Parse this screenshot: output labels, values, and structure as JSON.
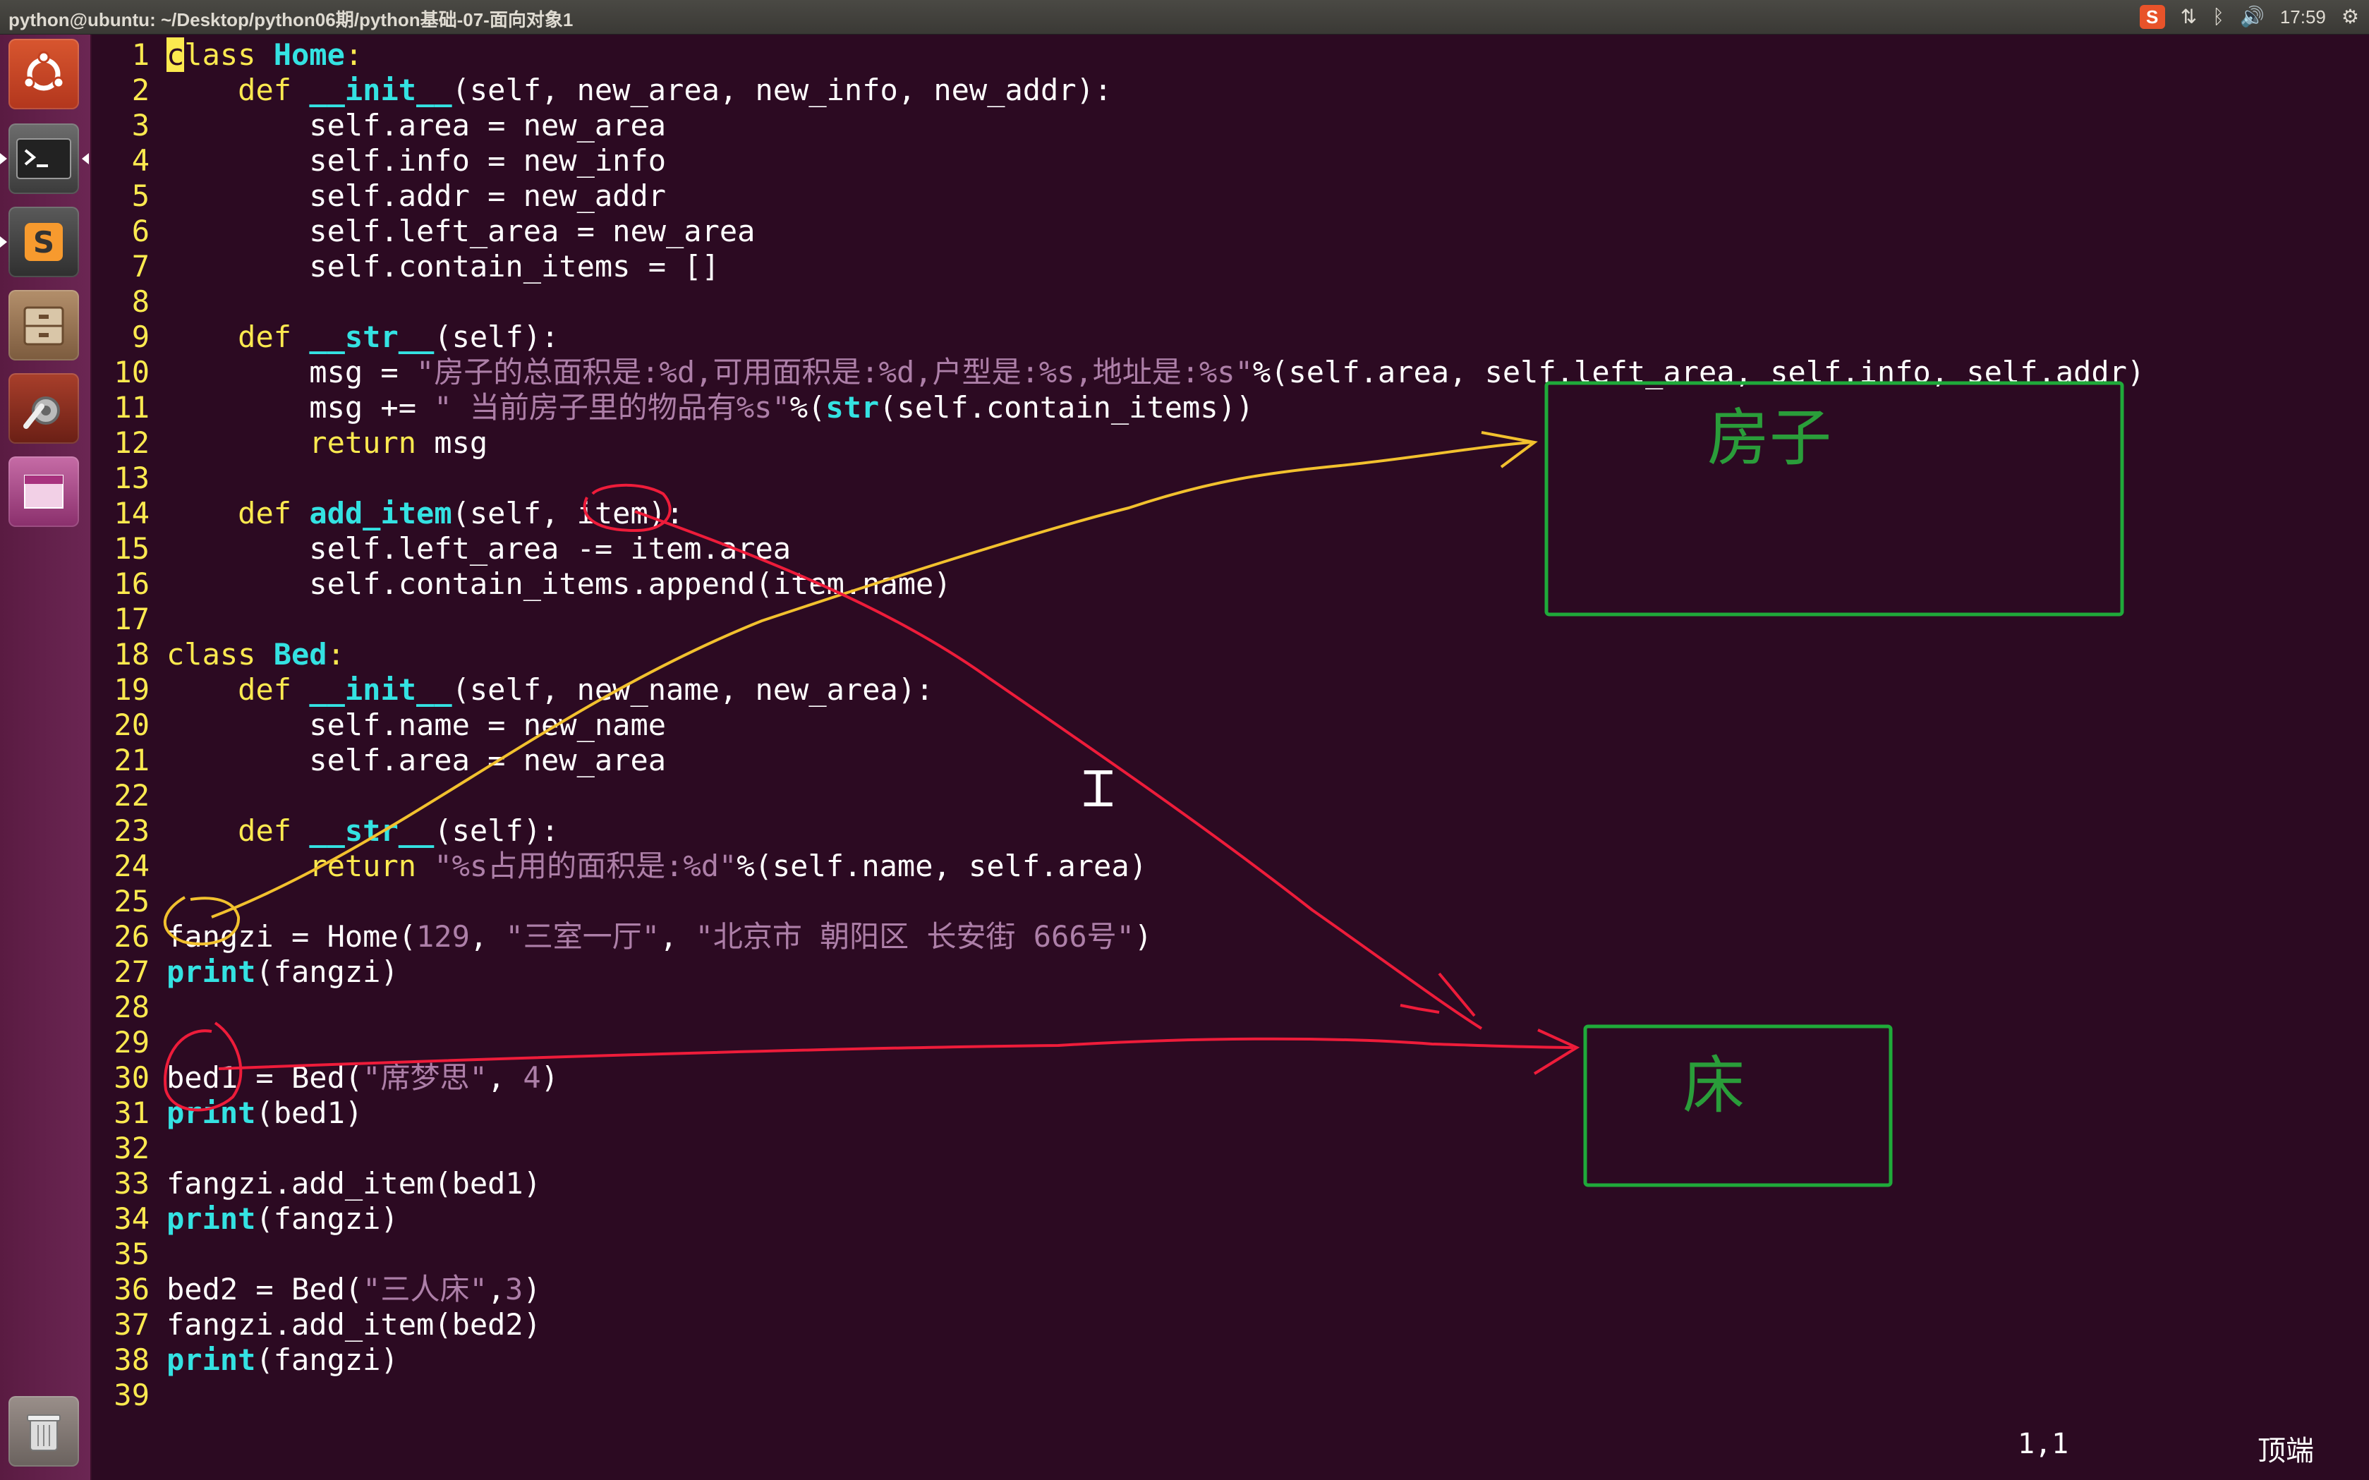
{
  "window_title": "python@ubuntu: ~/Desktop/python06期/python基础-07-面向对象1",
  "panel": {
    "indicators": [
      "sogou-input-icon",
      "network-icon",
      "bluetooth-icon",
      "volume-icon"
    ],
    "sogou_glyph": "S",
    "clock": "17:59"
  },
  "launcher": {
    "items": [
      {
        "name": "dash-home",
        "icon": "ubuntu-logo-icon"
      },
      {
        "name": "terminal",
        "icon": "terminal-icon",
        "glyph": ">_"
      },
      {
        "name": "sublime-text",
        "icon": "sublime-icon",
        "glyph": "S"
      },
      {
        "name": "files",
        "icon": "file-cabinet-icon"
      },
      {
        "name": "system-settings",
        "icon": "wrench-gear-icon"
      },
      {
        "name": "workspace-switcher",
        "icon": "workspace-icon"
      },
      {
        "name": "trash",
        "icon": "trash-icon"
      }
    ]
  },
  "editor": {
    "lines": [
      {
        "n": "1",
        "segs": [
          [
            "cursor",
            "c"
          ],
          [
            "kw",
            "lass "
          ],
          [
            "fn",
            "Home"
          ],
          [
            "",
            ""
          ],
          [
            "kw",
            ":"
          ]
        ]
      },
      {
        "n": "2",
        "segs": [
          [
            "",
            "    "
          ],
          [
            "kw",
            "def "
          ],
          [
            "fn",
            "__init__"
          ],
          [
            "",
            "(self, new_area, new_info, new_addr):"
          ]
        ]
      },
      {
        "n": "3",
        "segs": [
          [
            "",
            "        self.area = new_area"
          ]
        ]
      },
      {
        "n": "4",
        "segs": [
          [
            "",
            "        self.info = new_info"
          ]
        ]
      },
      {
        "n": "5",
        "segs": [
          [
            "",
            "        self.addr = new_addr"
          ]
        ]
      },
      {
        "n": "6",
        "segs": [
          [
            "",
            "        self.left_area = new_area"
          ]
        ]
      },
      {
        "n": "7",
        "segs": [
          [
            "",
            "        self.contain_items = []"
          ]
        ]
      },
      {
        "n": "8",
        "segs": []
      },
      {
        "n": "9",
        "segs": [
          [
            "",
            "    "
          ],
          [
            "kw",
            "def "
          ],
          [
            "fn",
            "__str__"
          ],
          [
            "",
            "(self):"
          ]
        ]
      },
      {
        "n": "10",
        "segs": [
          [
            "",
            "        msg = "
          ],
          [
            "str",
            "\"房子的总面积是:%d,可用面积是:%d,户型是:%s,地址是:%s\""
          ],
          [
            "",
            "%(self.area, self.left_area, self.info, self.addr)"
          ]
        ]
      },
      {
        "n": "11",
        "segs": [
          [
            "",
            "        msg += "
          ],
          [
            "str",
            "\" 当前房子里的物品有%s\""
          ],
          [
            "",
            "%("
          ],
          [
            "fn",
            "str"
          ],
          [
            "",
            "(self.contain_items))"
          ]
        ]
      },
      {
        "n": "12",
        "segs": [
          [
            "",
            "        "
          ],
          [
            "kw",
            "return"
          ],
          [
            "",
            " msg"
          ]
        ]
      },
      {
        "n": "13",
        "segs": []
      },
      {
        "n": "14",
        "segs": [
          [
            "",
            "    "
          ],
          [
            "kw",
            "def "
          ],
          [
            "fn",
            "add_item"
          ],
          [
            "",
            "(self, item):"
          ]
        ]
      },
      {
        "n": "15",
        "segs": [
          [
            "",
            "        self.left_area -= item.area"
          ]
        ]
      },
      {
        "n": "16",
        "segs": [
          [
            "",
            "        self.contain_items.append(item.name)"
          ]
        ]
      },
      {
        "n": "17",
        "segs": []
      },
      {
        "n": "18",
        "segs": [
          [
            "kw",
            "class "
          ],
          [
            "fn",
            "Bed"
          ],
          [
            "kw",
            ":"
          ]
        ]
      },
      {
        "n": "19",
        "segs": [
          [
            "",
            "    "
          ],
          [
            "kw",
            "def "
          ],
          [
            "fn",
            "__init__"
          ],
          [
            "",
            "(self, new_name, new_area):"
          ]
        ]
      },
      {
        "n": "20",
        "segs": [
          [
            "",
            "        self.name = new_name"
          ]
        ]
      },
      {
        "n": "21",
        "segs": [
          [
            "",
            "        self.area = new_area"
          ]
        ]
      },
      {
        "n": "22",
        "segs": []
      },
      {
        "n": "23",
        "segs": [
          [
            "",
            "    "
          ],
          [
            "kw",
            "def "
          ],
          [
            "fn",
            "__str__"
          ],
          [
            "",
            "(self):"
          ]
        ]
      },
      {
        "n": "24",
        "segs": [
          [
            "",
            "        "
          ],
          [
            "kw",
            "return"
          ],
          [
            "",
            " "
          ],
          [
            "str",
            "\"%s占用的面积是:%d\""
          ],
          [
            "",
            "%(self.name, self.area)"
          ]
        ]
      },
      {
        "n": "25",
        "segs": []
      },
      {
        "n": "26",
        "segs": [
          [
            "",
            "fangzi = Home("
          ],
          [
            "num",
            "129"
          ],
          [
            "",
            ", "
          ],
          [
            "str",
            "\"三室一厅\""
          ],
          [
            "",
            ", "
          ],
          [
            "str",
            "\"北京市 朝阳区 长安街 666号\""
          ],
          [
            "",
            ")"
          ]
        ]
      },
      {
        "n": "27",
        "segs": [
          [
            "fn",
            "print"
          ],
          [
            "",
            "(fangzi)"
          ]
        ]
      },
      {
        "n": "28",
        "segs": []
      },
      {
        "n": "29",
        "segs": []
      },
      {
        "n": "30",
        "segs": [
          [
            "",
            "bed1 = Bed("
          ],
          [
            "str",
            "\"席梦思\""
          ],
          [
            "",
            ", "
          ],
          [
            "num",
            "4"
          ],
          [
            "",
            ")"
          ]
        ]
      },
      {
        "n": "31",
        "segs": [
          [
            "fn",
            "print"
          ],
          [
            "",
            "(bed1)"
          ]
        ]
      },
      {
        "n": "32",
        "segs": []
      },
      {
        "n": "33",
        "segs": [
          [
            "",
            "fangzi.add_item(bed1)"
          ]
        ]
      },
      {
        "n": "34",
        "segs": [
          [
            "fn",
            "print"
          ],
          [
            "",
            "(fangzi)"
          ]
        ]
      },
      {
        "n": "35",
        "segs": []
      },
      {
        "n": "36",
        "segs": [
          [
            "",
            "bed2 = Bed("
          ],
          [
            "str",
            "\"三人床\""
          ],
          [
            "",
            ","
          ],
          [
            "num",
            "3"
          ],
          [
            "",
            ")"
          ]
        ]
      },
      {
        "n": "37",
        "segs": [
          [
            "",
            "fangzi.add_item(bed2)"
          ]
        ]
      },
      {
        "n": "38",
        "segs": [
          [
            "fn",
            "print"
          ],
          [
            "",
            "(fangzi)"
          ]
        ]
      },
      {
        "n": "39",
        "segs": []
      }
    ],
    "status": {
      "position": "1,1",
      "scroll": "顶端"
    }
  },
  "annotations": {
    "house_label": "房子",
    "bed_label": "床",
    "colors": {
      "box": "#1faa3a",
      "yellow_arrow": "#f2c12e",
      "red_arrow": "#ee1c3a",
      "box_text": "#2a9d3a"
    }
  }
}
